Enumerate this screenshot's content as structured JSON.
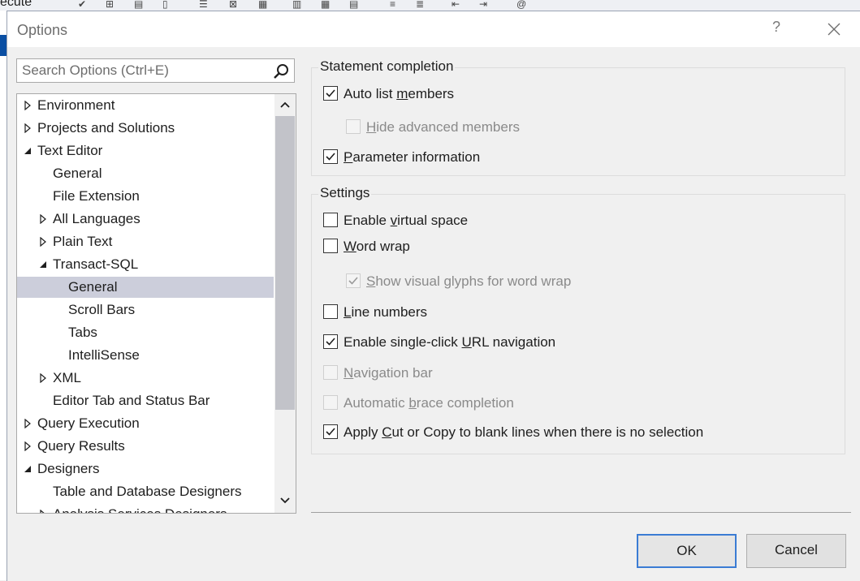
{
  "background_app": {
    "execute_label": "ecute"
  },
  "dialog": {
    "title": "Options",
    "help_label": "?"
  },
  "search": {
    "placeholder": "Search Options (Ctrl+E)",
    "value": ""
  },
  "tree": {
    "items": [
      {
        "label": "Environment",
        "level": 0,
        "state": "collapsed"
      },
      {
        "label": "Projects and Solutions",
        "level": 0,
        "state": "collapsed"
      },
      {
        "label": "Text Editor",
        "level": 0,
        "state": "expanded"
      },
      {
        "label": "General",
        "level": 1,
        "state": "leaf"
      },
      {
        "label": "File Extension",
        "level": 1,
        "state": "leaf"
      },
      {
        "label": "All Languages",
        "level": 1,
        "state": "collapsed"
      },
      {
        "label": "Plain Text",
        "level": 1,
        "state": "collapsed"
      },
      {
        "label": "Transact-SQL",
        "level": 1,
        "state": "expanded"
      },
      {
        "label": "General",
        "level": 2,
        "state": "leaf",
        "selected": true
      },
      {
        "label": "Scroll Bars",
        "level": 2,
        "state": "leaf"
      },
      {
        "label": "Tabs",
        "level": 2,
        "state": "leaf"
      },
      {
        "label": "IntelliSense",
        "level": 2,
        "state": "leaf"
      },
      {
        "label": "XML",
        "level": 1,
        "state": "collapsed"
      },
      {
        "label": "Editor Tab and Status Bar",
        "level": 1,
        "state": "leaf"
      },
      {
        "label": "Query Execution",
        "level": 0,
        "state": "collapsed"
      },
      {
        "label": "Query Results",
        "level": 0,
        "state": "collapsed"
      },
      {
        "label": "Designers",
        "level": 0,
        "state": "expanded"
      },
      {
        "label": "Table and Database Designers",
        "level": 1,
        "state": "leaf"
      },
      {
        "label": "Analysis Services Designers",
        "level": 1,
        "state": "collapsed"
      }
    ]
  },
  "statement_completion": {
    "title": "Statement completion",
    "options": [
      {
        "pre": "Auto list ",
        "key": "m",
        "post": "embers",
        "checked": true,
        "enabled": true
      },
      {
        "pre": "",
        "key": "H",
        "post": "ide advanced members",
        "checked": false,
        "enabled": false
      },
      {
        "pre": "",
        "key": "P",
        "post": "arameter information",
        "checked": true,
        "enabled": true
      }
    ]
  },
  "settings": {
    "title": "Settings",
    "options": [
      {
        "pre": "Enable ",
        "key": "v",
        "post": "irtual space",
        "checked": false,
        "enabled": true
      },
      {
        "pre": "",
        "key": "W",
        "post": "ord wrap",
        "checked": false,
        "enabled": true
      },
      {
        "pre": "",
        "key": "S",
        "post": "how visual glyphs for word wrap",
        "checked": true,
        "enabled": false
      },
      {
        "pre": "",
        "key": "L",
        "post": "ine numbers",
        "checked": false,
        "enabled": true
      },
      {
        "pre": "Enable single-click ",
        "key": "U",
        "post": "RL navigation",
        "checked": true,
        "enabled": true
      },
      {
        "pre": "",
        "key": "N",
        "post": "avigation bar",
        "checked": false,
        "enabled": false
      },
      {
        "pre": "Automatic ",
        "key": "b",
        "post": "race completion",
        "checked": false,
        "enabled": false
      },
      {
        "pre": "Apply ",
        "key": "C",
        "post": "ut or Copy to blank lines when there is no selection",
        "checked": true,
        "enabled": true
      }
    ]
  },
  "buttons": {
    "ok": "OK",
    "cancel": "Cancel"
  },
  "colors": {
    "selected_row": "#cccedb",
    "ok_border": "#3b7cd4"
  }
}
